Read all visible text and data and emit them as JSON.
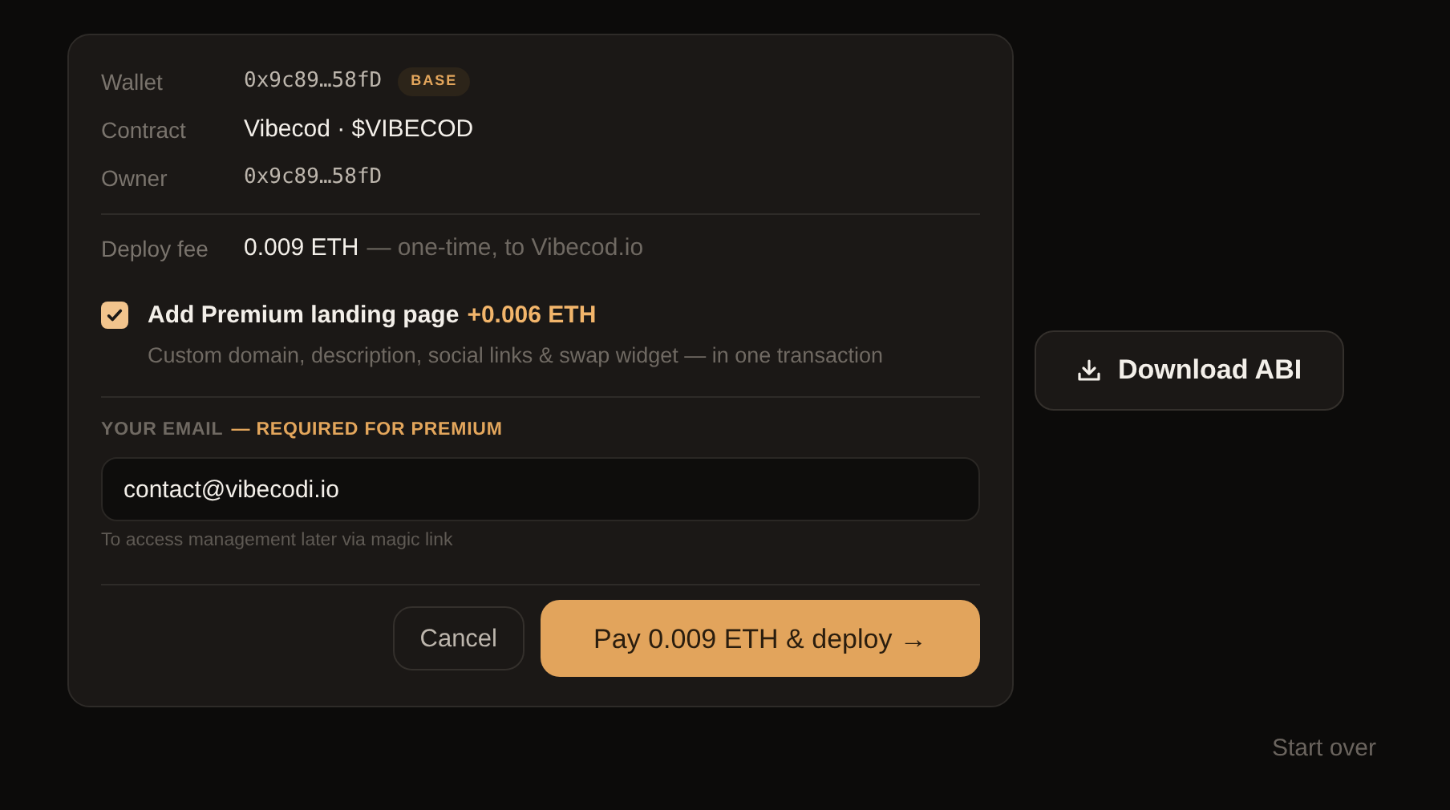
{
  "details": [
    {
      "kind": "address",
      "label": "Wallet",
      "value": "0x9c89…58fD",
      "badge": "BASE"
    },
    {
      "kind": "text",
      "label": "Contract",
      "value": "Vibecod · $VIBECOD"
    },
    {
      "kind": "address",
      "label": "Owner",
      "value": "0x9c89…58fD"
    }
  ],
  "fee": {
    "label": "Deploy fee",
    "amount": "0.009 ETH",
    "note": "— one-time, to Vibecod.io"
  },
  "premium": {
    "checked": true,
    "title": "Add Premium landing page",
    "price": "+0.006 ETH",
    "description": "Custom domain, description, social links & swap widget — in one transaction"
  },
  "email": {
    "label": "YOUR EMAIL",
    "required": "— REQUIRED FOR PREMIUM",
    "value": "contact@vibecodi.io",
    "hint": "To access management later via magic link"
  },
  "actions": {
    "cancel": "Cancel",
    "pay": "Pay 0.009 ETH & deploy →"
  },
  "download": {
    "label": "Download ABI"
  },
  "start_over": "Start over"
}
